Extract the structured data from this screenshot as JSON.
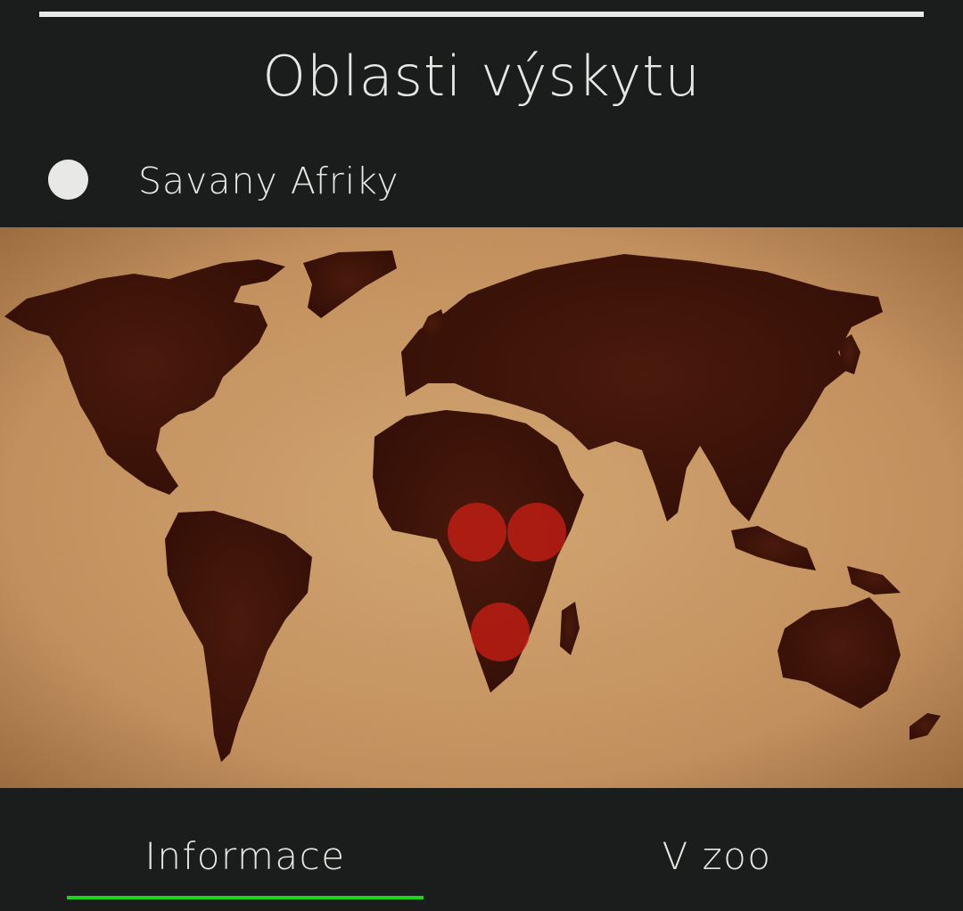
{
  "title": "Oblasti výskytu",
  "legend": {
    "label": "Savany Afriky",
    "dot_color": "#e8e8e6"
  },
  "map": {
    "marker_color": "#c81e14",
    "ocean_color": "#d2a06c",
    "land_color": "#3c1209"
  },
  "tabs": [
    {
      "label": "Informace",
      "active": true
    },
    {
      "label": "V zoo",
      "active": false
    }
  ],
  "colors": {
    "background": "#1b1c1c",
    "text": "#e6e6e3",
    "active_tab_indicator": "#1ed21e"
  }
}
